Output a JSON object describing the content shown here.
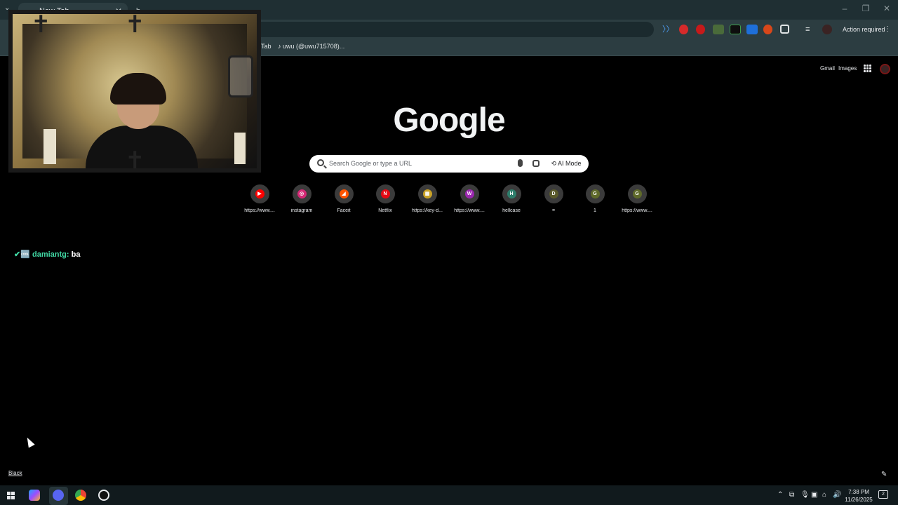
{
  "browser": {
    "tabs": [
      {
        "label": "New Tab",
        "active": true
      },
      {
        "label": "b",
        "active": false
      }
    ],
    "action_required_label": "Action required",
    "bookmarks": [
      {
        "label": "Tab"
      },
      {
        "label": "uwu (@uwu715708)..."
      }
    ]
  },
  "ntp": {
    "top_links": {
      "gmail": "Gmail",
      "images": "Images"
    },
    "logo_text": "Google",
    "search": {
      "placeholder": "Search Google or type a URL",
      "ai_mode_label": "AI Mode"
    },
    "shortcuts": [
      {
        "label": "https://www....",
        "icon": "youtube-icon",
        "color": "#ff0000",
        "glyph": "▶"
      },
      {
        "label": "instagram",
        "icon": "instagram-icon",
        "color": "#d62976",
        "glyph": "◎"
      },
      {
        "label": "Faceit",
        "icon": "faceit-icon",
        "color": "#ff5500",
        "glyph": "◢"
      },
      {
        "label": "Netflix",
        "icon": "netflix-icon",
        "color": "#e50914",
        "glyph": "N"
      },
      {
        "label": "https://key-d...",
        "icon": "gift-icon",
        "color": "#c9a227",
        "glyph": "▦"
      },
      {
        "label": "https://www....",
        "icon": "w-letter-icon",
        "color": "#9c27b0",
        "glyph": "W"
      },
      {
        "label": "hellcase",
        "icon": "h-letter-icon",
        "color": "#2e7d6b",
        "glyph": "H"
      },
      {
        "label": "=",
        "icon": "d-letter-icon",
        "color": "#5a5a2a",
        "glyph": "D"
      },
      {
        "label": "1",
        "icon": "g-letter-icon",
        "color": "#5f6a2a",
        "glyph": "G"
      },
      {
        "label": "https://www....",
        "icon": "g-letter-icon",
        "color": "#5f6a2a",
        "glyph": "G"
      }
    ],
    "customize_label": "Black"
  },
  "overlay": {
    "chat": {
      "badge_icons": "✔🆒",
      "user": "damiantg:",
      "message": "ba"
    }
  },
  "taskbar": {
    "time": "7:38 PM",
    "date": "11/26/2025",
    "notification_count": "2"
  }
}
